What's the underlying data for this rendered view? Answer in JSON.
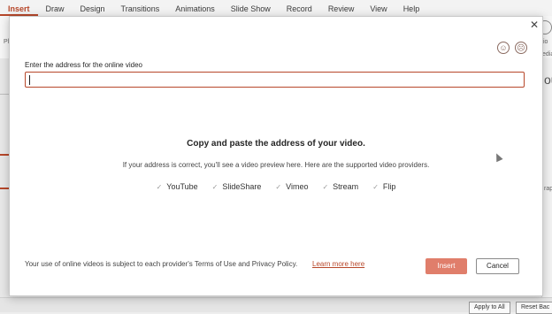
{
  "ribbon": {
    "tabs": [
      {
        "label": "Insert",
        "active": true
      },
      {
        "label": "Draw"
      },
      {
        "label": "Design"
      },
      {
        "label": "Transitions"
      },
      {
        "label": "Animations"
      },
      {
        "label": "Slide Show"
      },
      {
        "label": "Record"
      },
      {
        "label": "Review"
      },
      {
        "label": "View"
      },
      {
        "label": "Help"
      }
    ],
    "fragments": {
      "left": "Pl",
      "right_top": "io",
      "right_mid": "edia",
      "right_big": "ou",
      "right_lower": "rap"
    }
  },
  "background": {
    "apply_to_all": "Apply to All",
    "reset_button": "Reset Bac"
  },
  "dialog": {
    "close_symbol": "✕",
    "url_label": "Enter the address for the online video",
    "url_value": "",
    "info_title": "Copy and paste the address of your video.",
    "info_subtitle": "If your address is correct, you'll see a video preview here. Here are the supported video providers.",
    "check_symbol": "✓",
    "providers": [
      "YouTube",
      "SlideShare",
      "Vimeo",
      "Stream",
      "Flip"
    ],
    "terms_text": "Your use of online videos is subject to each provider's Terms of Use and Privacy Policy.",
    "learn_more": "Learn more here",
    "insert_label": "Insert",
    "cancel_label": "Cancel"
  },
  "colors": {
    "accent": "#b7472a",
    "insert_button": "#e07e6b"
  },
  "icons": [
    "close-icon",
    "smile-feedback-icon",
    "frown-feedback-icon",
    "check-icon",
    "mouse-pointer-icon"
  ]
}
